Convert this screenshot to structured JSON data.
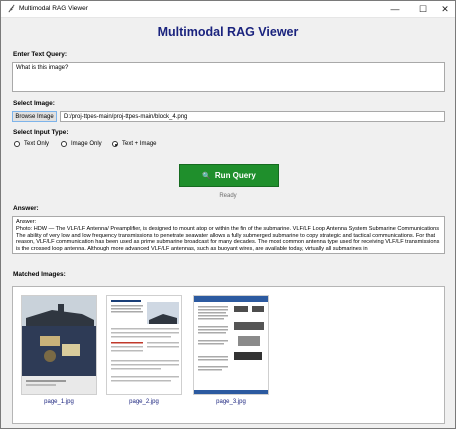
{
  "window": {
    "title": "Multimodal RAG Viewer",
    "minimize": "—",
    "maximize": "☐",
    "close": "✕"
  },
  "header": {
    "title": "Multimodal RAG Viewer"
  },
  "query": {
    "label": "Enter Text Query:",
    "value": "What is this image?"
  },
  "image": {
    "label": "Select Image:",
    "browse_label": "Browse Image",
    "path": "D:/proj-ttpes-main/proj-ttpes-main/block_4.png"
  },
  "input_type": {
    "label": "Select Input Type:",
    "options": [
      "Text Only",
      "Image Only",
      "Text + Image"
    ],
    "selected": "Text + Image"
  },
  "run": {
    "label": "Run Query",
    "icon": "search-icon"
  },
  "status": {
    "text": "Ready"
  },
  "answer": {
    "label": "Answer:",
    "text": "Answer:\nPhoto: HDW — The VLF/LF Antenna/ Preamplifier, is designed to mount atop or within the fin of the submarine. VLF/LF Loop Antenna System Submarine Communications The ability of very low and low frequency transmissions to penetrate seawater allows a fully submerged submarine to copy strategic and tactical communications. For that reason, VLF/LF communication has been used as prime submarine broadcast for many decades. The most common antenna type used for receiving VLF/LF transmissions is the crossed loop antenna. Although more advanced VLF/LF antennas, such as buoyant wires, are available today, virtually all submarines in"
  },
  "matched": {
    "label": "Matched Images:",
    "items": [
      {
        "caption": "page_1.jpg"
      },
      {
        "caption": "page_2.jpg"
      },
      {
        "caption": "page_3.jpg"
      }
    ]
  },
  "colors": {
    "title_blue": "#1a237e",
    "run_green": "#1f8f2c"
  }
}
